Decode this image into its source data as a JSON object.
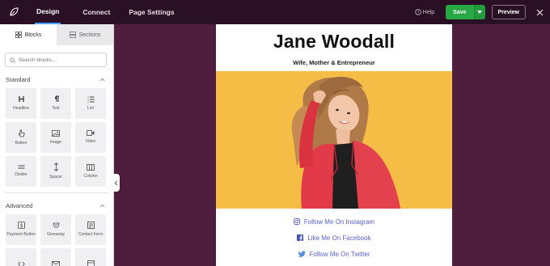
{
  "topbar": {
    "tabs": [
      {
        "label": "Design"
      },
      {
        "label": "Connect"
      },
      {
        "label": "Page Settings"
      }
    ],
    "help_label": "Help",
    "save_label": "Save",
    "preview_label": "Preview"
  },
  "sidebar": {
    "tabs": [
      {
        "label": "Blocks"
      },
      {
        "label": "Sections"
      }
    ],
    "search": {
      "placeholder": "Search blocks..."
    },
    "standard": {
      "title": "Standard",
      "blocks": [
        {
          "label": "Headline",
          "icon": "heading-icon"
        },
        {
          "label": "Text",
          "icon": "paragraph-icon"
        },
        {
          "label": "List",
          "icon": "list-icon"
        },
        {
          "label": "Button",
          "icon": "pointer-icon"
        },
        {
          "label": "Image",
          "icon": "image-icon"
        },
        {
          "label": "Video",
          "icon": "video-icon"
        },
        {
          "label": "Divider",
          "icon": "divider-icon"
        },
        {
          "label": "Spacer",
          "icon": "spacer-icon"
        },
        {
          "label": "Column",
          "icon": "column-icon"
        }
      ]
    },
    "advanced": {
      "title": "Advanced",
      "blocks": [
        {
          "label": "Payment Button",
          "icon": "dollar-icon"
        },
        {
          "label": "Giveaway",
          "icon": "giveaway-icon"
        },
        {
          "label": "Contact Form",
          "icon": "form-icon"
        }
      ]
    }
  },
  "page": {
    "headline": "Jane Woodall",
    "subheadline": "Wife, Mother & Entrepreneur",
    "hero_background": "#f5bd45",
    "links": [
      {
        "label": "Follow Me On Instagram",
        "icon": "instagram-icon"
      },
      {
        "label": "Like Me On Facebook",
        "icon": "facebook-icon"
      },
      {
        "label": "Follow Me On Twitter",
        "icon": "twitter-icon"
      }
    ],
    "link_color": "#5b5fcf"
  },
  "colors": {
    "topbar": "#2a1024",
    "canvas": "#4f1e3f",
    "save": "#28a745",
    "accent": "#4ba0ff"
  }
}
